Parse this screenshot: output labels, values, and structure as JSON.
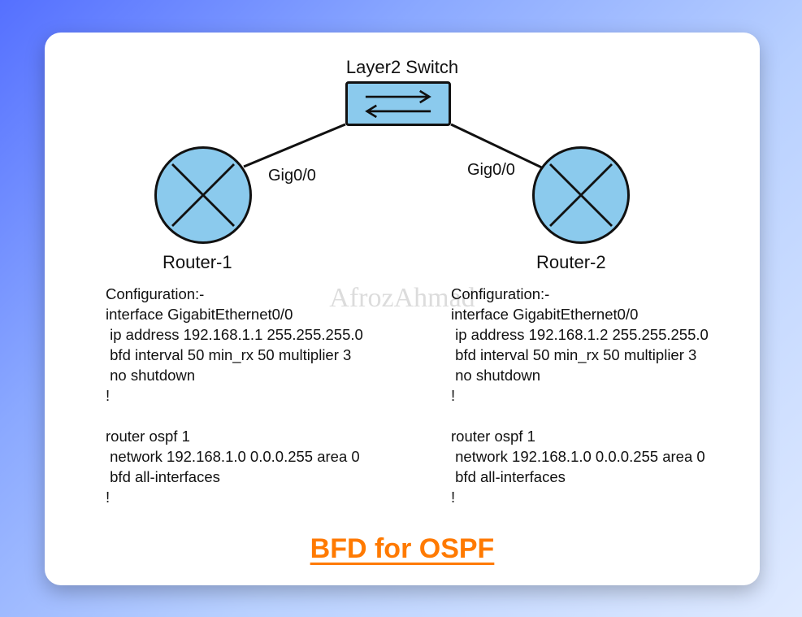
{
  "diagram": {
    "switch_label": "Layer2 Switch",
    "router1": {
      "name": "Router-1",
      "interface_label": "Gig0/0"
    },
    "router2": {
      "name": "Router-2",
      "interface_label": "Gig0/0"
    }
  },
  "config1": {
    "header": "Configuration:-",
    "lines": [
      "interface GigabitEthernet0/0",
      " ip address 192.168.1.1 255.255.255.0",
      " bfd interval 50 min_rx 50 multiplier 3",
      " no shutdown",
      "!",
      "",
      "router ospf 1",
      " network 192.168.1.0 0.0.0.255 area 0",
      " bfd all-interfaces",
      "!"
    ]
  },
  "config2": {
    "header": "Configuration:-",
    "lines": [
      "interface GigabitEthernet0/0",
      " ip address 192.168.1.2 255.255.255.0",
      " bfd interval 50 min_rx 50 multiplier 3",
      " no shutdown",
      "!",
      "",
      "router ospf 1",
      " network 192.168.1.0 0.0.0.255 area 0",
      " bfd all-interfaces",
      "!"
    ]
  },
  "watermark": "AfrozAhmad",
  "title": "BFD for OSPF"
}
